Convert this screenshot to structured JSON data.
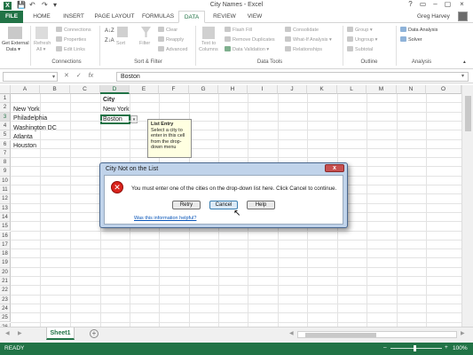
{
  "window": {
    "title": "City Names - Excel",
    "help": "?",
    "ribbon_display": "▭",
    "minimize": "–",
    "restore": "▢",
    "close": "×"
  },
  "qat": {
    "save": "💾",
    "undo": "↶",
    "redo": "↷",
    "customize": "▾"
  },
  "tabs": [
    {
      "label": "FILE"
    },
    {
      "label": "HOME"
    },
    {
      "label": "INSERT"
    },
    {
      "label": "PAGE LAYOUT"
    },
    {
      "label": "FORMULAS"
    },
    {
      "label": "DATA"
    },
    {
      "label": "REVIEW"
    },
    {
      "label": "VIEW"
    }
  ],
  "user": {
    "name": "Greg Harvey"
  },
  "ribbon": {
    "get_external_1": "Get External",
    "get_external_2": "Data ▾",
    "refresh_1": "Refresh",
    "refresh_2": "All ▾",
    "connections": "Connections",
    "properties": "Properties",
    "edit_links": "Edit Links",
    "group_connections": "Connections",
    "sort": "Sort",
    "filter": "Filter",
    "clear": "Clear",
    "reapply": "Reapply",
    "advanced": "Advanced",
    "group_sortfilter": "Sort & Filter",
    "text_to_1": "Text to",
    "text_to_2": "Columns",
    "flash_fill": "Flash Fill",
    "remove_dup": "Remove Duplicates",
    "data_validation": "Data Validation ▾",
    "consolidate": "Consolidate",
    "whatif": "What-If Analysis ▾",
    "relationships": "Relationships",
    "group_datatools": "Data Tools",
    "group_btn": "Group ▾",
    "ungroup": "Ungroup ▾",
    "subtotal": "Subtotal",
    "group_outline": "Outline",
    "data_analysis": "Data Analysis",
    "solver": "Solver",
    "group_analysis": "Analysis",
    "collapse": "▴"
  },
  "formula_bar": {
    "namebox": "",
    "namebox_arrow": "▾",
    "cancel": "✕",
    "enter": "✓",
    "fx": "fx",
    "value": "Boston",
    "expand": "▾"
  },
  "columns": [
    "A",
    "B",
    "C",
    "D",
    "E",
    "F",
    "G",
    "H",
    "I",
    "J",
    "K",
    "L",
    "M",
    "N",
    "O"
  ],
  "rows": [
    "1",
    "2",
    "3",
    "4",
    "5",
    "6",
    "7",
    "8",
    "9",
    "10",
    "11",
    "12",
    "13",
    "14",
    "15",
    "16",
    "17",
    "18",
    "19",
    "20",
    "21",
    "22",
    "23",
    "24",
    "25",
    "26"
  ],
  "cells": {
    "A2": "New York",
    "A3": "Philadelphia",
    "A4": "Washington DC",
    "A5": "Atlanta",
    "A6": "Houston",
    "D1": "City",
    "D2": "New York",
    "D3": "Boston",
    "dd_arrow": "▾"
  },
  "input_message": {
    "title": "List Entry",
    "body": "Select a city to enter in this cell from the drop-down menu"
  },
  "dialog": {
    "title": "City Not on the List",
    "close": "x",
    "icon": "✕",
    "message": "You must enter one of the cities on the drop-down list here. Click Cancel to continue.",
    "retry": "Retry",
    "cancel": "Cancel",
    "help": "Help",
    "link": "Was this information helpful?"
  },
  "sheets": {
    "nav_prev": "◀",
    "nav_next": "▶",
    "active": "Sheet1",
    "add": "+",
    "scroll_left": "◀",
    "scroll_right": "▶"
  },
  "status": {
    "text": "READY",
    "zoom_minus": "–",
    "zoom_plus": "+",
    "zoom": "100%"
  },
  "colors": {
    "excel_green": "#217346",
    "dialog_frame": "#c0d3ea",
    "error_red": "#d9231c",
    "tooltip_bg": "#ffffe1"
  }
}
